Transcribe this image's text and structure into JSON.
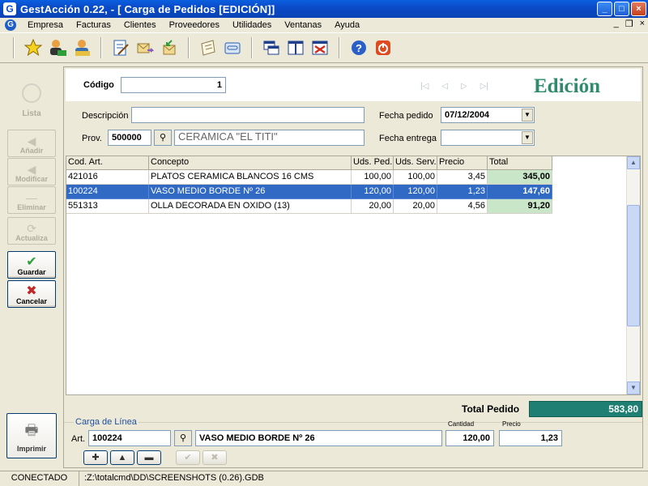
{
  "window": {
    "title": "GestAcción 0.22,  - [ Carga de Pedidos   [EDICIÓN]]"
  },
  "menu": {
    "items": [
      "Empresa",
      "Facturas",
      "Clientes",
      "Proveedores",
      "Utilidades",
      "Ventanas",
      "Ayuda"
    ],
    "mdi_minimize": "_",
    "mdi_restore": "❐",
    "mdi_close": "×"
  },
  "toolbar": {
    "icons": [
      "star-icon",
      "client-icon",
      "provider-icon",
      "edit-doc-icon",
      "forward-mail-icon",
      "receive-mail-icon",
      "notepad-icon",
      "id-card-icon",
      "windows-cascade-icon",
      "windows-tile-icon",
      "windows-close-icon",
      "help-icon",
      "power-icon"
    ]
  },
  "side": {
    "lista": "Lista",
    "anadir": "Añadir",
    "modificar": "Modificar",
    "eliminar": "Eliminar",
    "actualiza": "Actualiza",
    "guardar": "Guardar",
    "cancelar": "Cancelar",
    "imprimir": "Imprimir"
  },
  "form": {
    "codigo_label": "Código",
    "codigo_value": "1",
    "mode_label": "Edición",
    "descripcion_label": "Descripción",
    "descripcion_value": "",
    "fecha_pedido_label": "Fecha pedido",
    "fecha_pedido_value": "07/12/2004",
    "prov_label": "Prov.",
    "prov_code": "500000",
    "prov_name": "CERAMICA \"EL TITI\"",
    "fecha_entrega_label": "Fecha entrega",
    "fecha_entrega_value": ""
  },
  "grid": {
    "columns": [
      "Cod. Art.",
      "Concepto",
      "Uds. Ped.",
      "Uds. Serv.",
      "Precio",
      "Total"
    ],
    "rows": [
      {
        "cod": "421016",
        "concepto": "PLATOS CERAMICA BLANCOS 16 CMS",
        "uds_ped": "100,00",
        "uds_serv": "100,00",
        "precio": "3,45",
        "total": "345,00",
        "selected": false
      },
      {
        "cod": "100224",
        "concepto": "VASO MEDIO BORDE Nº 26",
        "uds_ped": "120,00",
        "uds_serv": "120,00",
        "precio": "1,23",
        "total": "147,60",
        "selected": true
      },
      {
        "cod": "551313",
        "concepto": "OLLA DECORADA EN OXIDO (13)",
        "uds_ped": "20,00",
        "uds_serv": "20,00",
        "precio": "4,56",
        "total": "91,20",
        "selected": false
      }
    ]
  },
  "totals": {
    "label": "Total Pedido",
    "value": "583,80"
  },
  "linea": {
    "title": "Carga de Línea",
    "art_label": "Art.",
    "art_code": "100224",
    "art_name": "VASO MEDIO BORDE Nº 26",
    "cantidad_label": "Cantidad",
    "cantidad_value": "120,00",
    "precio_label": "Precio",
    "precio_value": "1,23"
  },
  "status": {
    "connection": "CONECTADO",
    "path": ":Z:\\totalcmd\\DD\\SCREENSHOTS (0.26).GDB"
  },
  "colors": {
    "titlebar": "#0A4BC8",
    "selection": "#316AC5",
    "total_cell": "#C9E7C8",
    "total_pedido": "#1E7F72",
    "edicion": "#2E8B6C"
  }
}
